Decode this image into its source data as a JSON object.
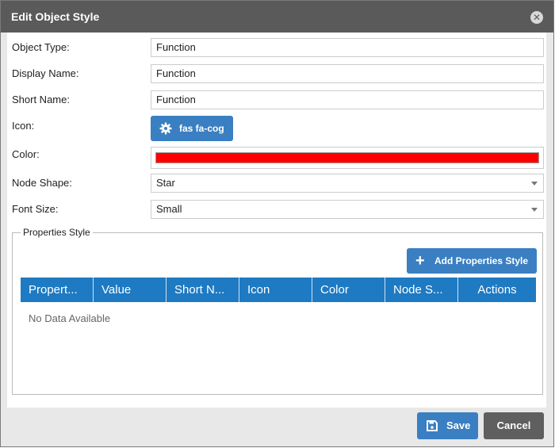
{
  "dialog": {
    "title": "Edit Object Style",
    "close_glyph": "✕"
  },
  "form": {
    "object_type": {
      "label": "Object Type:",
      "value": "Function"
    },
    "display_name": {
      "label": "Display Name:",
      "value": "Function"
    },
    "short_name": {
      "label": "Short Name:",
      "value": "Function"
    },
    "icon": {
      "label": "Icon:",
      "button_label": "fas fa-cog",
      "icon_name": "gear-icon"
    },
    "color": {
      "label": "Color:",
      "value": "#ff0000"
    },
    "node_shape": {
      "label": "Node Shape:",
      "value": "Star"
    },
    "font_size": {
      "label": "Font Size:",
      "value": "Small"
    }
  },
  "properties_style": {
    "legend": "Properties Style",
    "add_button_label": "Add Properties Style",
    "columns": [
      "Propert...",
      "Value",
      "Short N...",
      "Icon",
      "Color",
      "Node S...",
      "Actions"
    ],
    "empty_text": "No Data Available"
  },
  "footer": {
    "save_label": "Save",
    "cancel_label": "Cancel"
  },
  "colors": {
    "primary": "#3a7fc1",
    "grid_header": "#1e7ac2",
    "titlebar": "#5a5a5a",
    "cancel": "#5f5f5f"
  }
}
